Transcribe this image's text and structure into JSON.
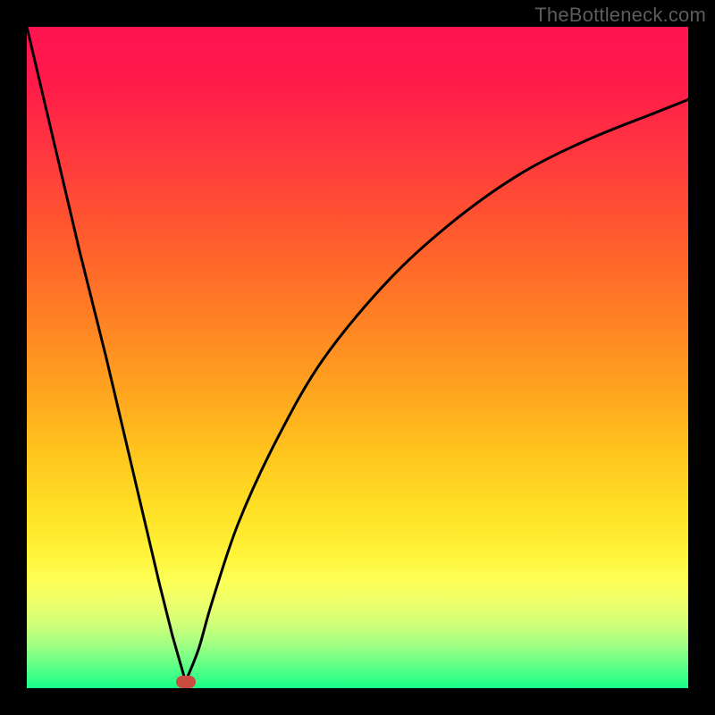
{
  "attribution": "TheBottleneck.com",
  "colors": {
    "frame": "#000000",
    "gradient_top": "#ff1450",
    "gradient_bottom": "#18ff88",
    "curve_stroke": "#000000",
    "marker_fill": "#cc4b40"
  },
  "chart_data": {
    "type": "line",
    "title": "",
    "xlabel": "",
    "ylabel": "",
    "xlim": [
      0,
      100
    ],
    "ylim": [
      0,
      100
    ],
    "grid": false,
    "legend": false,
    "notes": "V-shaped bottleneck curve. Left branch descends steeply and nearly linearly from top-left to the minimum near x≈24. Right branch rises with a convex (square-root-like) shape toward the upper-right. Background is a vertical red→yellow→green gradient indicating bottleneck severity (top=high, bottom=none). A small rounded red marker sits at the curve minimum.",
    "series": [
      {
        "name": "bottleneck-curve",
        "x": [
          0,
          4,
          8,
          12,
          16,
          20,
          22,
          24,
          26,
          28,
          32,
          38,
          45,
          55,
          65,
          75,
          85,
          95,
          100
        ],
        "y": [
          100,
          83,
          66,
          50,
          33,
          16,
          8,
          1,
          6,
          13,
          25,
          38,
          50,
          62,
          71,
          78,
          83,
          87,
          89
        ]
      }
    ],
    "marker": {
      "x": 24,
      "y": 1
    }
  }
}
